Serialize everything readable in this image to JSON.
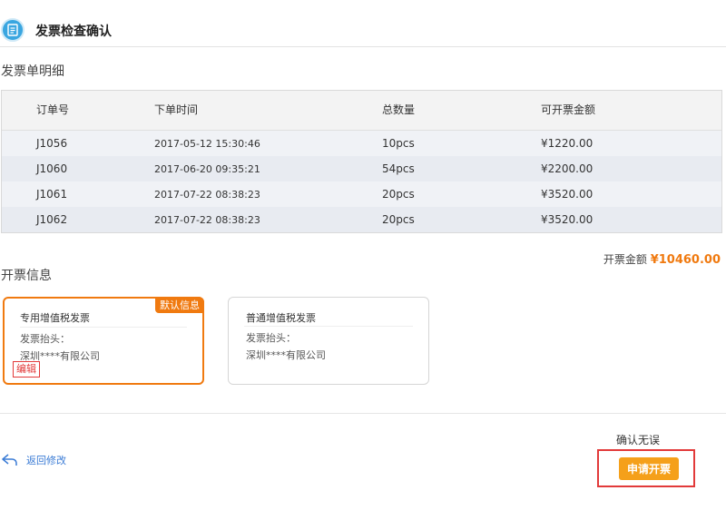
{
  "header": {
    "title": "发票检查确认",
    "icon": "invoice-icon"
  },
  "detail": {
    "title": "发票单明细",
    "columns": [
      "订单号",
      "下单时间",
      "总数量",
      "可开票金额"
    ],
    "rows": [
      {
        "order": "J1056",
        "time": "2017-05-12  15:30:46",
        "qty": "10pcs",
        "amount": "¥1220.00"
      },
      {
        "order": "J1060",
        "time": "2017-06-20  09:35:21",
        "qty": "54pcs",
        "amount": "¥2200.00"
      },
      {
        "order": "J1061",
        "time": "2017-07-22  08:38:23",
        "qty": "20pcs",
        "amount": "¥3520.00"
      },
      {
        "order": "J1062",
        "time": "2017-07-22  08:38:23",
        "qty": "20pcs",
        "amount": "¥3520.00"
      }
    ]
  },
  "total": {
    "label": "开票金额",
    "amount": "¥10460.00"
  },
  "invoice_info": {
    "title": "开票信息",
    "cards": [
      {
        "type": "专用增值税发票",
        "label": "发票抬头：",
        "company": "深圳****有限公司",
        "badge": "默认信息",
        "edit": "编辑"
      },
      {
        "type": "普通增值税发票",
        "label": "发票抬头：",
        "company": "深圳****有限公司"
      }
    ]
  },
  "footer": {
    "back_label": "返回修改",
    "confirm_label": "确认无误",
    "apply_label": "申请开票"
  },
  "colors": {
    "accent": "#f07a10",
    "button": "#f5a01a",
    "link": "#3a7bd5",
    "highlight": "#e23a3a"
  }
}
